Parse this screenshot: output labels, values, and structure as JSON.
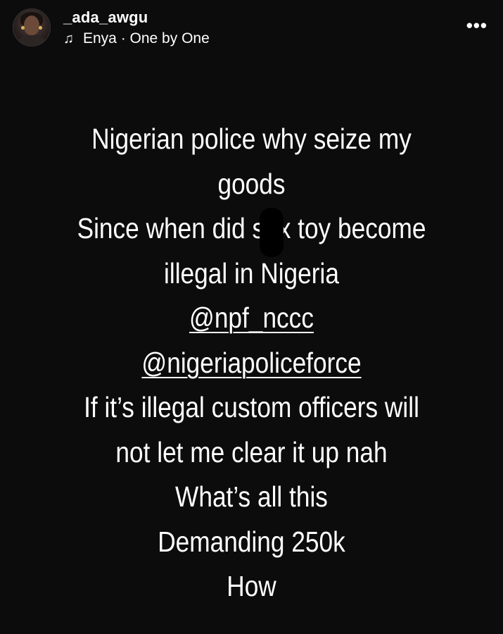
{
  "header": {
    "username": "_ada_awgu",
    "music_icon": "music-note-icon",
    "music_label": "Enya · One by One",
    "more_icon": "more-options-icon"
  },
  "caption": {
    "line1": "Nigerian police why seize my",
    "line2": "goods",
    "line3": "Since when did s  x toy become",
    "line4": "illegal in Nigeria",
    "mention1": "@npf_nccc",
    "mention2": "@nigeriapoliceforce",
    "line5": "If it’s illegal custom officers will",
    "line6": "not let me clear it up nah",
    "line7": "What’s all this",
    "line8": "Demanding 250k",
    "line9": "How"
  },
  "colors": {
    "background": "#0d0c0c",
    "text": "#ffffff"
  }
}
